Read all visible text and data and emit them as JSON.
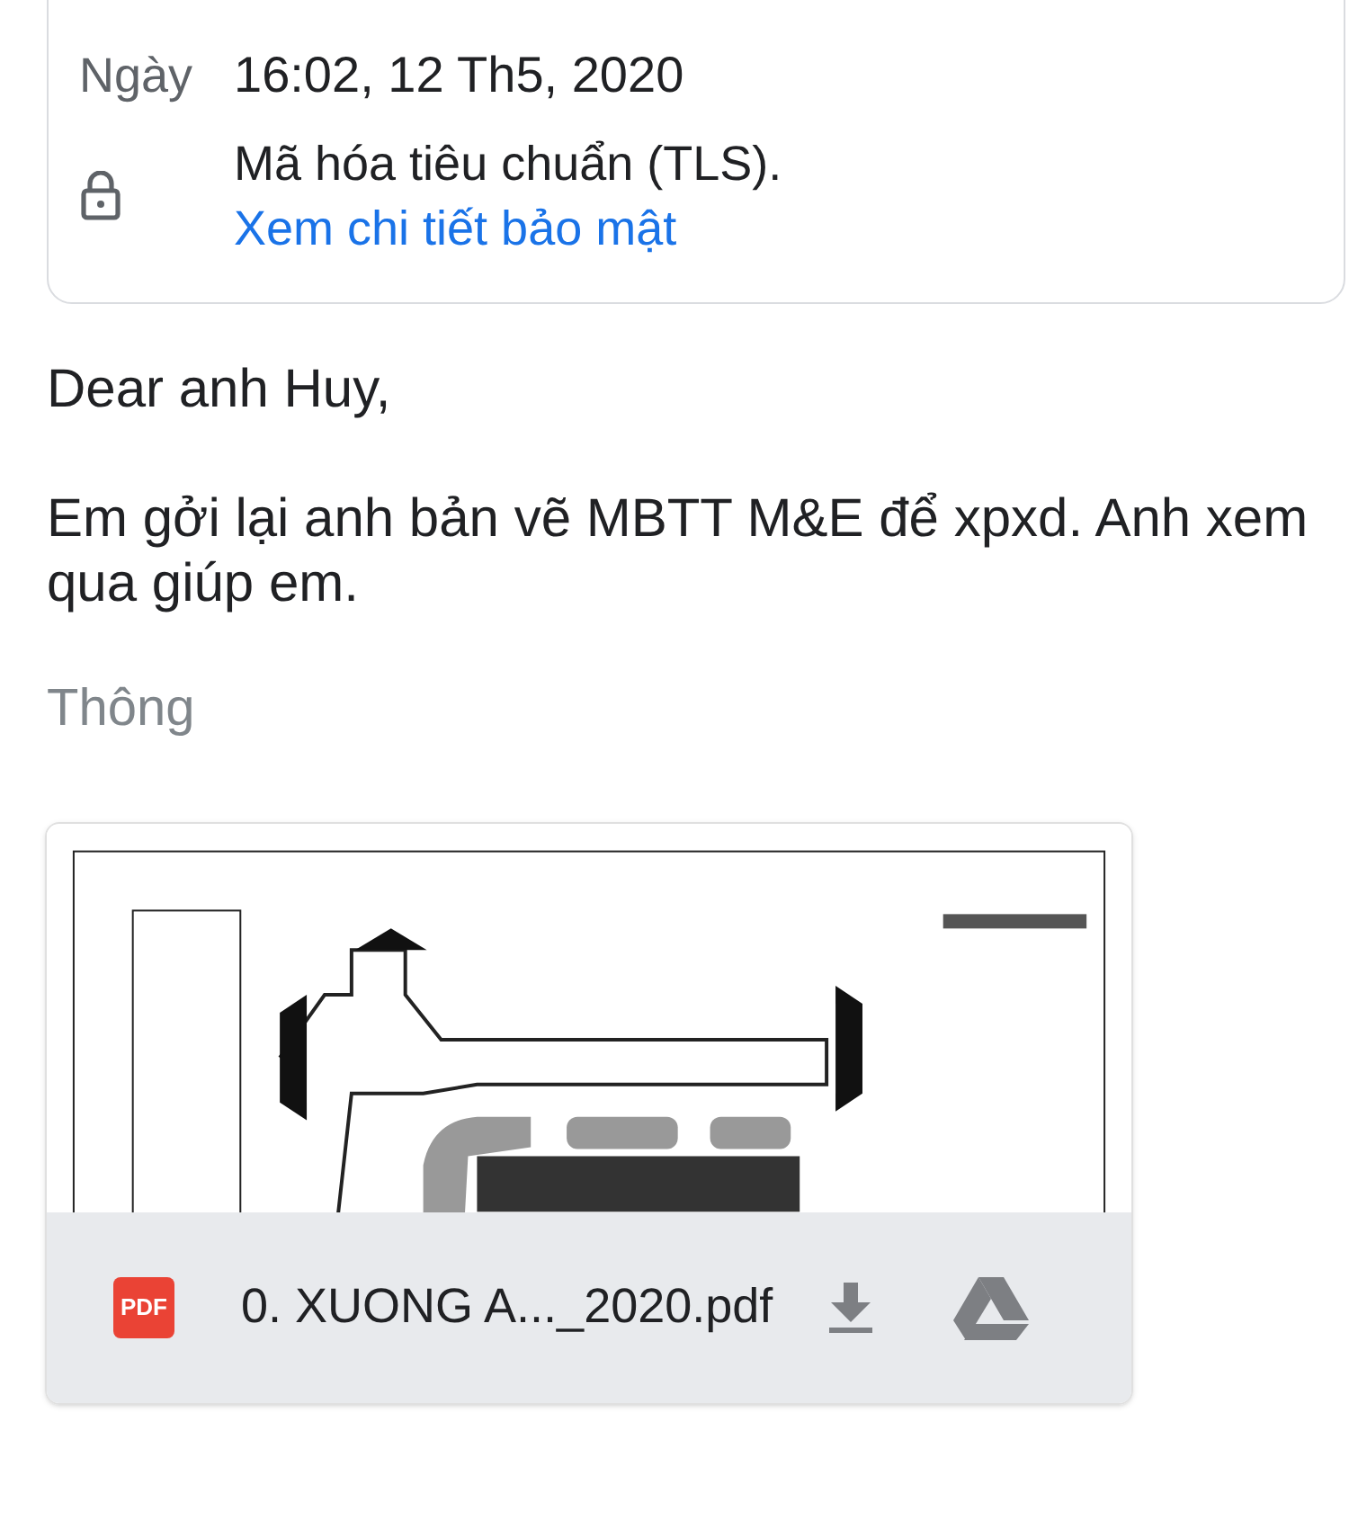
{
  "details": {
    "date_label": "Ngày",
    "date_value": "16:02, 12 Th5, 2020",
    "security_text": "Mã hóa tiêu chuẩn (TLS).",
    "security_link": "Xem chi tiết bảo mật"
  },
  "body": [
    "Dear anh Huy,",
    "Em gởi lại anh bản vẽ MBTT M&E để xpxd. Anh xem qua giúp em."
  ],
  "signature_toggle": "Thông",
  "attachment": {
    "type_badge": "PDF",
    "file_name": "0. XUONG A..._2020.pdf"
  }
}
